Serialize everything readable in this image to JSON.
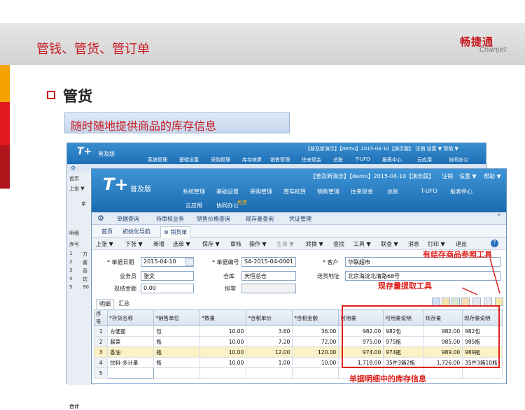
{
  "slide": {
    "title": "管钱、管货、管订单",
    "logo_cn": "畅捷通",
    "logo_en": "Chanjet",
    "subtitle": "管货",
    "callout": "随时随地提供商品的库存信息",
    "colors": {
      "red": "#c8191f",
      "orange": "#f4a300",
      "blue": "#1c6bb0"
    }
  },
  "back_window": {
    "logo": "T+",
    "edition": "普及版",
    "status": "【普及新演示】【demo】2015-04-10【演示版】 注销  设置 ▼  帮助 ▼",
    "menus": [
      "系统管理",
      "基础设置",
      "采购管理",
      "库存核算",
      "销售管理",
      "往来现金",
      "总账",
      "T-UFO",
      "报表中心",
      "云应用",
      "协同办公"
    ],
    "left_items": [
      "首页",
      "上张 ▼",
      "单",
      "明细",
      "序号",
      "1",
      "2",
      "3",
      "4",
      "5",
      "合计"
    ],
    "left_rows": [
      "方",
      "酱",
      "香",
      "饮",
      "90"
    ]
  },
  "front_window": {
    "logo": "T+",
    "edition": "普及版",
    "status": "【普及新演示】【demo】2015-04-10【演示版】",
    "status_links": [
      "注销",
      "设置 ▼",
      "帮助 ▼"
    ],
    "menus_row1": [
      "系统管理",
      "基础设置",
      "采购管理",
      "库存核算",
      "销售管理",
      "往来现金",
      "总账",
      "T-UFO",
      "报表中心"
    ],
    "menus_row2": [
      "云应用",
      "协同办公"
    ],
    "badge": "免费",
    "subnav": [
      "单据查询",
      "待审核业务",
      "销售价格查询",
      "现存量查询",
      "凭证管理"
    ],
    "tabs": [
      "首页",
      "初始化导航",
      "销货单"
    ],
    "toolbar": [
      "上张 ▼",
      "下张 ▼",
      "新增",
      "选单 ▼",
      "保存 ▼",
      "审核",
      "操作 ▼",
      "生单 ▼",
      "转换 ▼",
      "查找",
      "工具 ▼",
      "联查 ▼",
      "消息",
      "打印 ▼",
      "退出"
    ],
    "form": {
      "date_label": "* 单据日期",
      "date_value": "2015-04-10",
      "number_label": "* 单据编号",
      "number_value": "SA-2015-04-0001",
      "customer_label": "* 客户",
      "customer_value": "华联超市",
      "salesman_label": "业务员",
      "salesman_value": "张文",
      "warehouse_label": "仓库",
      "warehouse_value": "天恒总仓",
      "address_label": "送货地址",
      "address_value": "北京海淀北清路68号",
      "amount_label": "现结金额",
      "amount_value": "0.00",
      "sort_label": "排零"
    },
    "detail_tabs": [
      "明细",
      "汇总"
    ],
    "grid": {
      "headers": [
        "序号",
        "*存货名称",
        "*销售单位",
        "*数量",
        "*含税单价",
        "*含税金额",
        "可用量",
        "可用量说明",
        "现存量",
        "现存量说明"
      ],
      "rows": [
        [
          "1",
          "方便面",
          "包",
          "10.00",
          "3.60",
          "36.00",
          "982.00",
          "982包",
          "982.00",
          "982包"
        ],
        [
          "2",
          "酱菜",
          "瓶",
          "10.00",
          "7.20",
          "72.00",
          "975.00",
          "975瓶",
          "985.00",
          "985瓶"
        ],
        [
          "3",
          "香油",
          "瓶",
          "10.00",
          "12.00",
          "120.00",
          "974.00",
          "974瓶",
          "989.00",
          "989瓶"
        ],
        [
          "4",
          "饮料-多计量",
          "瓶",
          "10.00",
          "1.00",
          "10.00",
          "1,718.00",
          "35件3箱2瓶",
          "1,726.00",
          "35件3箱10瓶"
        ],
        [
          "5",
          "",
          "",
          "",
          "",
          "",
          "",
          "",
          "",
          ""
        ]
      ]
    }
  },
  "annotations": {
    "ref_tool": "有结存商品参照工具",
    "qty_tool": "现存量提取工具",
    "detail_info": "单据明细中的库存信息"
  }
}
